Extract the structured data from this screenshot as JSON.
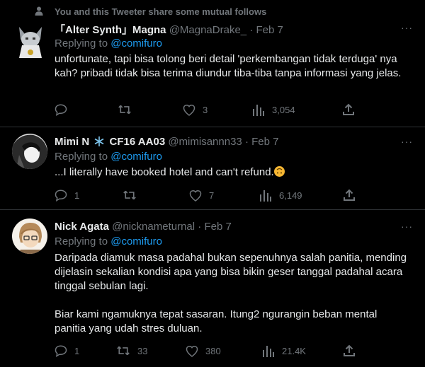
{
  "mutual_follows": {
    "text": "You and this Tweeter share some mutual follows",
    "icon": "person-icon"
  },
  "tweets": [
    {
      "display_name": "「Alter Synth」Magna",
      "handle": "@MagnaDrake_",
      "dot": "·",
      "date": "Feb 7",
      "replying_prefix": "Replying to",
      "replying_to": "@comifuro",
      "text": [
        "unfortunate, tapi bisa tolong beri detail 'perkembangan tidak terduga' nya kah? pribadi tidak bisa terima diundur tiba-tiba tanpa informasi yang jelas."
      ],
      "actions": {
        "replies": "",
        "retweets": "",
        "likes": "3",
        "views": "3,054"
      }
    },
    {
      "display_name": "Mimi N",
      "name_suffix": "CF16 AA03",
      "handle": "@mimisannn33",
      "dot": "·",
      "date": "Feb 7",
      "replying_prefix": "Replying to",
      "replying_to": "@comifuro",
      "text": [
        "...I literally have booked hotel and can't refund."
      ],
      "actions": {
        "replies": "1",
        "retweets": "",
        "likes": "7",
        "views": "6,149"
      }
    },
    {
      "display_name": "Nick Agata",
      "handle": "@nicknameturnal",
      "dot": "·",
      "date": "Feb 7",
      "replying_prefix": "Replying to",
      "replying_to": "@comifuro",
      "text": [
        "Daripada diamuk masa padahal bukan sepenuhnya salah panitia, mending dijelasin sekalian kondisi apa yang bisa bikin geser tanggal padahal acara tinggal sebulan lagi.",
        "Biar kami ngamuknya tepat sasaran. Itung2 ngurangin beban mental panitia yang udah stres duluan."
      ],
      "actions": {
        "replies": "1",
        "retweets": "33",
        "likes": "380",
        "views": "21.4K"
      }
    }
  ],
  "more_label": "···",
  "icons": [
    "reply-icon",
    "retweet-icon",
    "like-icon",
    "views-icon",
    "share-icon",
    "snowflake-icon"
  ],
  "colors": {
    "background": "#000000",
    "text": "#e7e9ea",
    "muted": "#71767b",
    "link": "#1d9bf0",
    "divider": "#2f3336"
  }
}
